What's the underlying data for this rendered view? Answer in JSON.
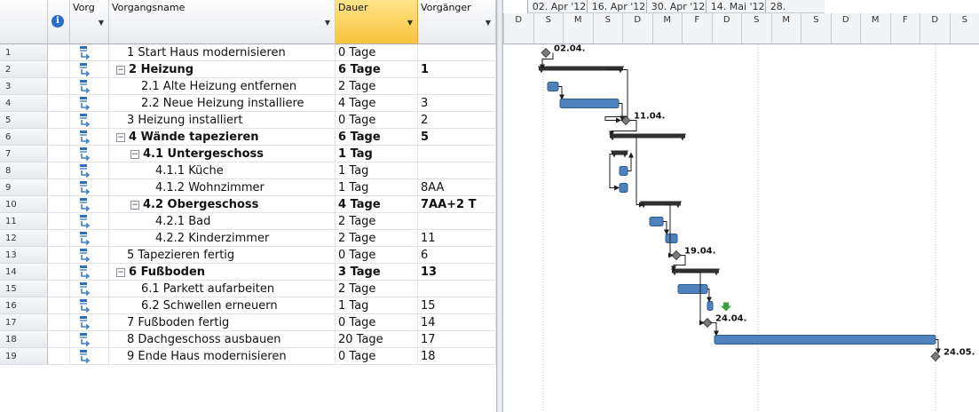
{
  "columns": {
    "info_icon": "info-icon",
    "predecessor_mode": "Vorg",
    "name": "Vorgangsname",
    "duration": "Dauer",
    "predecessors": "Vorgänger"
  },
  "rows": [
    {
      "id": "1",
      "name": "1 Start Haus modernisieren",
      "duration": "0 Tage",
      "pred": "",
      "bold": false,
      "indent": 0,
      "collapse": false
    },
    {
      "id": "2",
      "name": "2 Heizung",
      "duration": "6 Tage",
      "pred": "1",
      "bold": true,
      "indent": 0,
      "collapse": true
    },
    {
      "id": "3",
      "name": "2.1 Alte Heizung entfernen",
      "duration": "2 Tage",
      "pred": "",
      "bold": false,
      "indent": 1,
      "collapse": false
    },
    {
      "id": "4",
      "name": "2.2 Neue Heizung installiere",
      "duration": "4 Tage",
      "pred": "3",
      "bold": false,
      "indent": 1,
      "collapse": false
    },
    {
      "id": "5",
      "name": "3 Heizung installiert",
      "duration": "0 Tage",
      "pred": "2",
      "bold": false,
      "indent": 0,
      "collapse": false
    },
    {
      "id": "6",
      "name": "4 Wände tapezieren",
      "duration": "6 Tage",
      "pred": "5",
      "bold": true,
      "indent": 0,
      "collapse": true
    },
    {
      "id": "7",
      "name": "4.1 Untergeschoss",
      "duration": "1 Tag",
      "pred": "",
      "bold": true,
      "indent": 1,
      "collapse": true
    },
    {
      "id": "8",
      "name": "4.1.1 Küche",
      "duration": "1 Tag",
      "pred": "",
      "bold": false,
      "indent": 2,
      "collapse": false
    },
    {
      "id": "9",
      "name": "4.1.2 Wohnzimmer",
      "duration": "1 Tag",
      "pred": "8AA",
      "bold": false,
      "indent": 2,
      "collapse": false
    },
    {
      "id": "10",
      "name": "4.2 Obergeschoss",
      "duration": "4 Tage",
      "pred": "7AA+2 T",
      "bold": true,
      "indent": 1,
      "collapse": true
    },
    {
      "id": "11",
      "name": "4.2.1 Bad",
      "duration": "2 Tage",
      "pred": "",
      "bold": false,
      "indent": 2,
      "collapse": false
    },
    {
      "id": "12",
      "name": "4.2.2 Kinderzimmer",
      "duration": "2 Tage",
      "pred": "11",
      "bold": false,
      "indent": 2,
      "collapse": false
    },
    {
      "id": "13",
      "name": "5 Tapezieren fertig",
      "duration": "0 Tage",
      "pred": "6",
      "bold": false,
      "indent": 0,
      "collapse": false
    },
    {
      "id": "14",
      "name": "6 Fußboden",
      "duration": "3 Tage",
      "pred": "13",
      "bold": true,
      "indent": 0,
      "collapse": true
    },
    {
      "id": "15",
      "name": "6.1 Parkett aufarbeiten",
      "duration": "2 Tage",
      "pred": "",
      "bold": false,
      "indent": 1,
      "collapse": false
    },
    {
      "id": "16",
      "name": "6.2 Schwellen erneuern",
      "duration": "1 Tag",
      "pred": "15",
      "bold": false,
      "indent": 1,
      "collapse": false
    },
    {
      "id": "17",
      "name": "7 Fußboden fertig",
      "duration": "0 Tage",
      "pred": "14",
      "bold": false,
      "indent": 0,
      "collapse": false
    },
    {
      "id": "18",
      "name": "8 Dachgeschoss ausbauen",
      "duration": "20 Tage",
      "pred": "17",
      "bold": false,
      "indent": 0,
      "collapse": false
    },
    {
      "id": "19",
      "name": "9 Ende Haus modernisieren",
      "duration": "0 Tage",
      "pred": "18",
      "bold": false,
      "indent": 0,
      "collapse": false
    }
  ],
  "timescale": {
    "weeks": [
      "02. Apr '12",
      "16. Apr '12",
      "30. Apr '12",
      "14. Mai '12",
      "28."
    ],
    "days": [
      "D",
      "S",
      "M",
      "S",
      "D",
      "M",
      "F",
      "D",
      "S",
      "M",
      "S",
      "D",
      "M",
      "F",
      "D",
      "S"
    ]
  },
  "gantt": {
    "milestone_labels": [
      "02.04.",
      "11.04.",
      "19.04.",
      "24.04.",
      "24.05."
    ],
    "colors": {
      "task": "#4f81bd",
      "summary": "#303030",
      "link": "#1f1f1f",
      "milestone": "#7a7a7a",
      "flag": "#3ca03c"
    }
  }
}
